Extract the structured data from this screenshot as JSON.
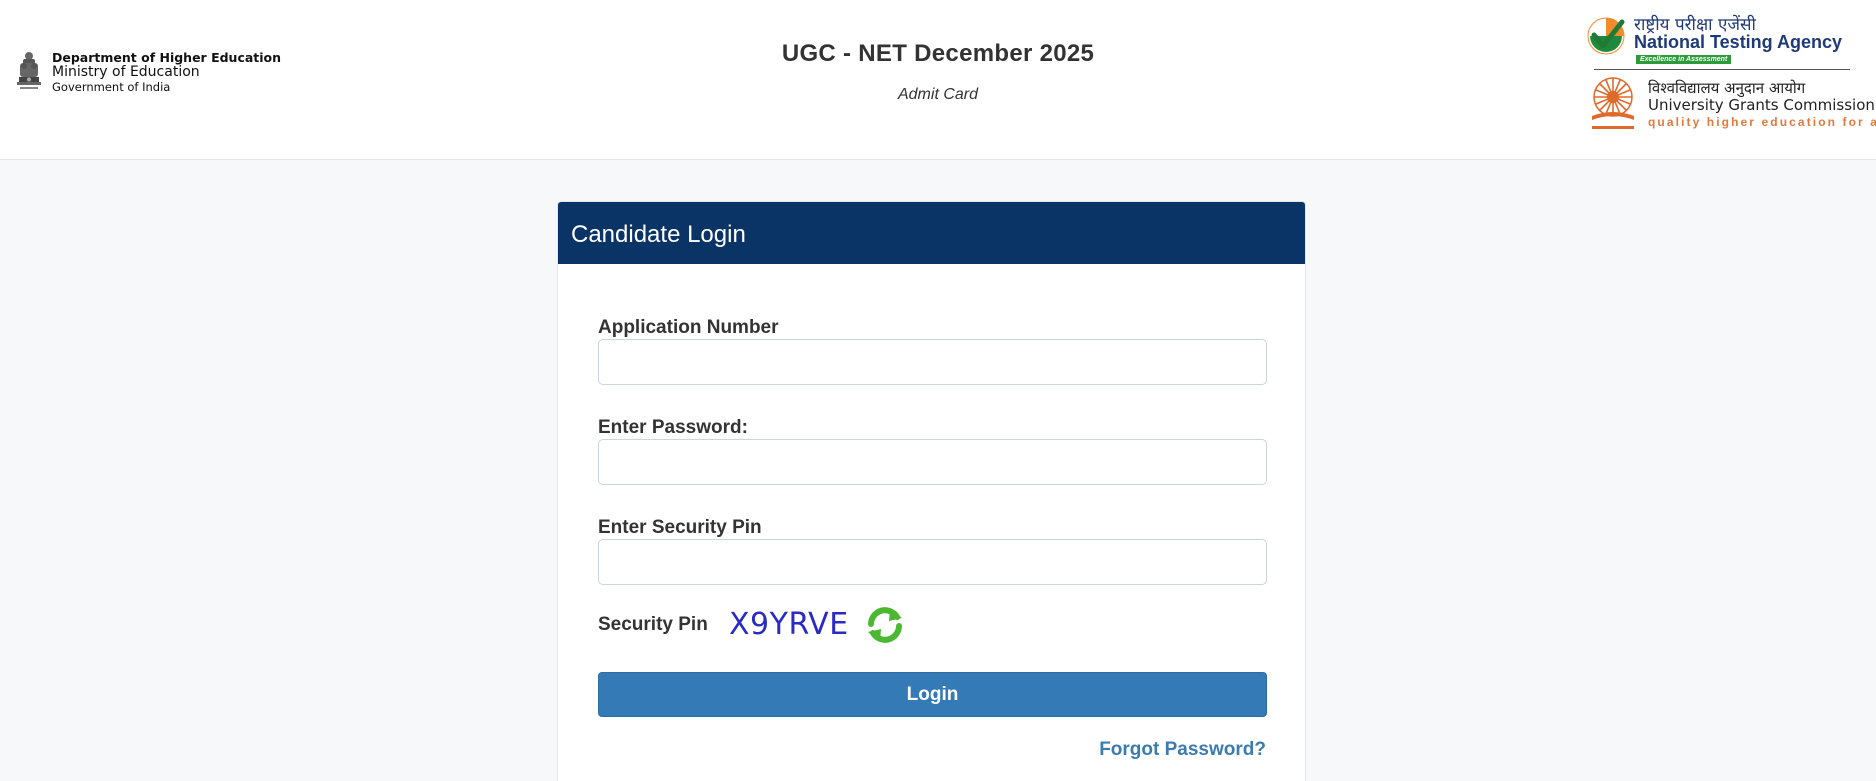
{
  "header": {
    "ministry": {
      "line1": "Department of Higher Education",
      "line2": "Ministry of Education",
      "line3": "Government of India"
    },
    "title": "UGC - NET December 2025",
    "subtitle": "Admit Card",
    "nta": {
      "hindi": "राष्ट्रीय परीक्षा एजेंसी",
      "name": "National Testing Agency",
      "tagline": "Excellence in Assessment"
    },
    "ugc": {
      "hindi": "विश्वविद्यालय अनुदान आयोग",
      "name": "University Grants Commission",
      "tagline": "quality higher education for all"
    }
  },
  "login": {
    "heading": "Candidate Login",
    "fields": {
      "application_number": {
        "label": "Application Number",
        "value": "",
        "placeholder": ""
      },
      "password": {
        "label": "Enter Password:",
        "value": "",
        "placeholder": ""
      },
      "security_pin": {
        "label": "Enter Security Pin",
        "value": "",
        "placeholder": ""
      }
    },
    "captcha": {
      "label": "Security Pin",
      "code": "X9YRVE",
      "refresh_icon": "refresh-icon"
    },
    "submit_label": "Login",
    "forgot_label": "Forgot Password?"
  },
  "colors": {
    "header_bar": "#0a3466",
    "login_button": "#347ab7",
    "link": "#3a7cae",
    "captcha_text": "#2a2ac4",
    "page_bg": "#f6f8fa"
  }
}
